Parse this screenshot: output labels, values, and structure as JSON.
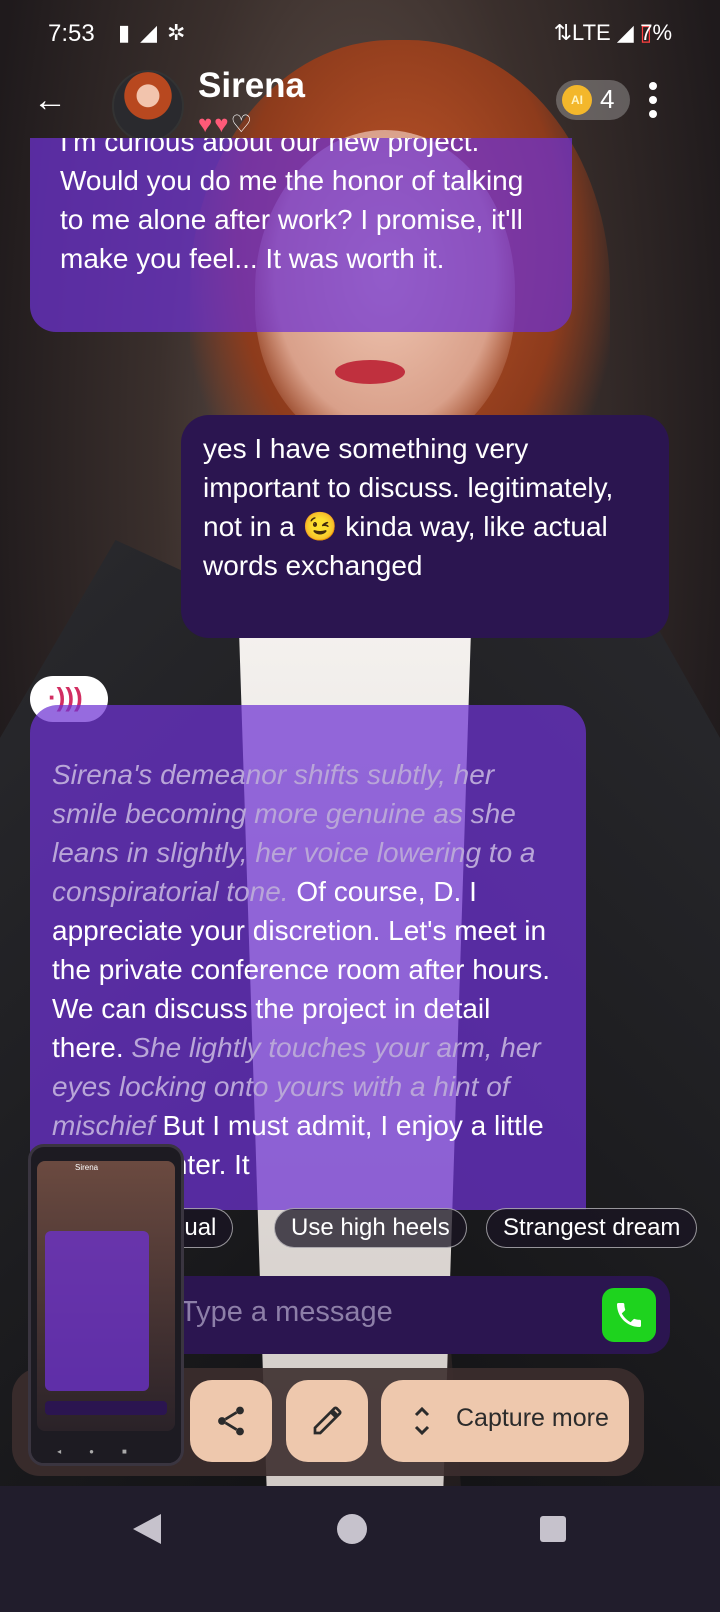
{
  "status": {
    "time": "7:53",
    "network": "LTE",
    "battery": "7%"
  },
  "header": {
    "name": "Sirena",
    "hearts_filled": 2,
    "hearts_total": 3,
    "coins": "4",
    "coin_badge": "AI"
  },
  "messages": [
    {
      "role": "ai",
      "text": "I'm curious about our new project. Would you do me the honor of talking to me alone after work? I promise, it'll make you feel... It was worth it."
    },
    {
      "role": "user",
      "text": "yes I have something very important to discuss. legitimately, not in a 😉 kinda way, like actual words exchanged"
    },
    {
      "role": "ai",
      "action1": "Sirena's demeanor shifts subtly, her smile becoming more genuine as she leans in slightly, her voice lowering to a conspiratorial tone.",
      "speech1": "Of course, D. I appreciate your discretion. Let's meet in the private conference room after hours. We can discuss the project in detail there.",
      "action2": "She lightly touches your arm, her eyes locking onto yours with a hint of mischief",
      "speech2": "But I must admit, I enjoy a little playful banter. It"
    }
  ],
  "suggestions": [
    "Sexual",
    "Use high heels",
    "Strangest dream"
  ],
  "input": {
    "placeholder": "Type a message"
  },
  "actions": {
    "capture_more": "Capture more"
  },
  "icons": {
    "back": "arrow-left-icon",
    "menu": "kebab-menu-icon",
    "audio": "speaker-icon",
    "call": "phone-icon",
    "share": "share-icon",
    "edit": "pencil-icon",
    "expand": "expand-vertical-icon"
  },
  "colors": {
    "ai_bubble": "#6e32d2",
    "user_bubble": "#2b1550",
    "action_button": "#eec8ad",
    "call_button": "#1ed31e",
    "heart": "#ff5a78"
  }
}
